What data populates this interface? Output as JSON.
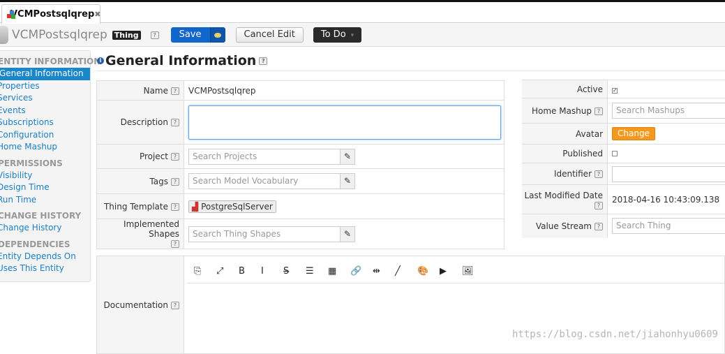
{
  "tab": {
    "title": "VCMPostsqlqrep",
    "close": "✖"
  },
  "toolbar": {
    "entity_name": "VCMPostsqlqrep",
    "type_badge": "Thing",
    "help": "?",
    "save": "Save",
    "cancel": "Cancel Edit",
    "todo": "To Do",
    "todo_caret": "▾"
  },
  "sidebar": {
    "sections": [
      {
        "header": "ENTITY INFORMATION",
        "items": [
          "General Information",
          "Properties",
          "Services",
          "Events",
          "Subscriptions",
          "Configuration",
          "Home Mashup"
        ]
      },
      {
        "header": "PERMISSIONS",
        "items": [
          "Visibility",
          "Design Time",
          "Run Time"
        ]
      },
      {
        "header": "CHANGE HISTORY",
        "items": [
          "Change History"
        ]
      },
      {
        "header": "DEPENDENCIES",
        "items": [
          "Entity Depends On",
          "Uses This Entity"
        ]
      }
    ],
    "active": "General Information"
  },
  "page": {
    "title": "General Information",
    "help": "?"
  },
  "left_form": {
    "name": {
      "label": "Name",
      "value": "VCMPostsqlqrep"
    },
    "description": {
      "label": "Description",
      "value": ""
    },
    "project": {
      "label": "Project",
      "placeholder": "Search Projects"
    },
    "tags": {
      "label": "Tags",
      "placeholder": "Search Model Vocabulary"
    },
    "thing_template": {
      "label": "Thing Template",
      "value": "PostgreSqlServer"
    },
    "implemented_shapes": {
      "label": "Implemented Shapes",
      "placeholder": "Search Thing Shapes"
    },
    "documentation": {
      "label": "Documentation"
    }
  },
  "right_form": {
    "active": {
      "label": "Active",
      "checked": true
    },
    "home_mashup": {
      "label": "Home Mashup",
      "placeholder": "Search Mashups"
    },
    "avatar": {
      "label": "Avatar",
      "button": "Change"
    },
    "published": {
      "label": "Published",
      "checked": false
    },
    "identifier": {
      "label": "Identifier",
      "value": ""
    },
    "last_modified": {
      "label": "Last Modified Date",
      "value": "2018-04-16 10:43:09.138"
    },
    "value_stream": {
      "label": "Value Stream",
      "placeholder": "Search Thing"
    }
  },
  "editor_tools": [
    {
      "name": "source-icon",
      "glyph": "⎘"
    },
    {
      "name": "fullscreen-icon",
      "glyph": "⤢"
    },
    {
      "name": "bold-icon",
      "glyph": "B"
    },
    {
      "name": "italic-icon",
      "glyph": "I"
    },
    {
      "name": "strikethrough-icon",
      "glyph": "S̶"
    },
    {
      "name": "list-icon",
      "glyph": "☰"
    },
    {
      "name": "table-icon",
      "glyph": "▦"
    },
    {
      "name": "link-icon",
      "glyph": "🔗"
    },
    {
      "name": "unlink-icon",
      "glyph": "⇹"
    },
    {
      "name": "horizontal-rule-icon",
      "glyph": "╱"
    },
    {
      "name": "color-icon",
      "glyph": "🎨"
    },
    {
      "name": "video-icon",
      "glyph": "▶"
    },
    {
      "name": "image-icon",
      "glyph": "🖼"
    }
  ],
  "watermark": "https://blog.csdn.net/jiahonhyu0609",
  "colors": {
    "accent": "#1a86cc",
    "save": "#1166cc",
    "change": "#f39a1e"
  }
}
